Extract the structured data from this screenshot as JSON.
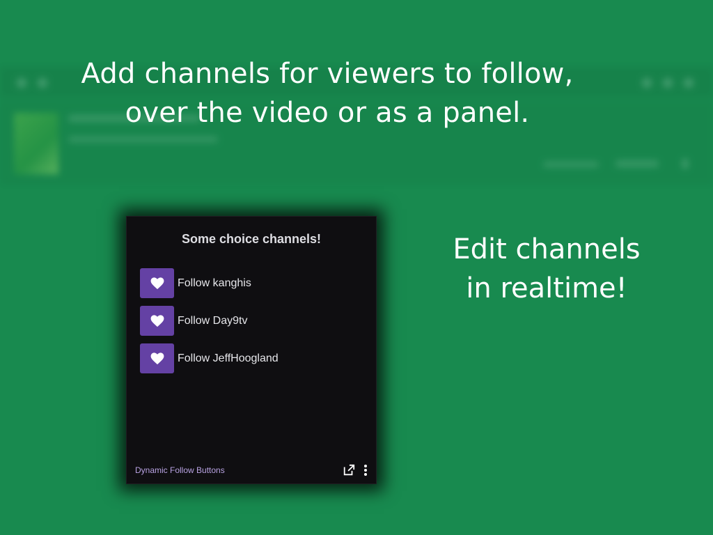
{
  "headline": {
    "line1": "Add channels for viewers to follow,",
    "line2": "over the video or as a panel."
  },
  "side_note": {
    "line1": "Edit channels",
    "line2": "in realtime!"
  },
  "panel": {
    "title": "Some choice channels!",
    "items": [
      {
        "label": "Follow kanghis",
        "icon": "heart-icon"
      },
      {
        "label": "Follow Day9tv",
        "icon": "heart-icon"
      },
      {
        "label": "Follow JeffHoogland",
        "icon": "heart-icon"
      }
    ],
    "footer": {
      "extension_name": "Dynamic Follow Buttons",
      "popout_icon": "popout-icon",
      "more_icon": "more-vertical-icon"
    }
  },
  "colors": {
    "background": "#188a4f",
    "panel_bg": "#0f0e11",
    "button": "#6441a4",
    "link": "#b9a3e3"
  }
}
